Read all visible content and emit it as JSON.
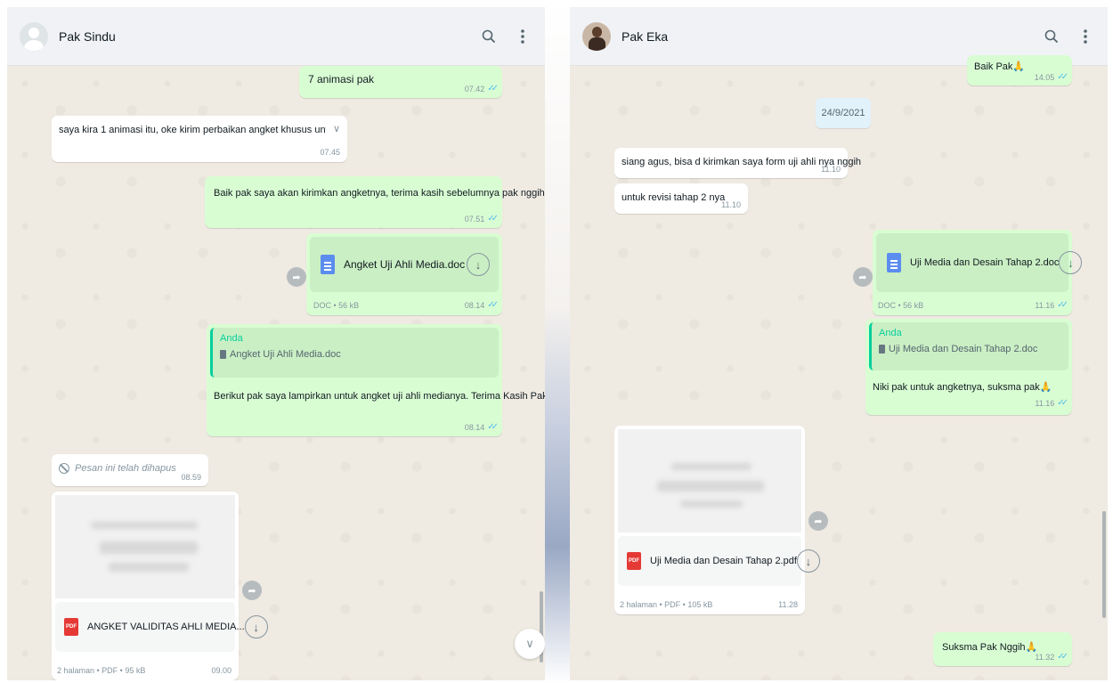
{
  "left_chat": {
    "contact_name": "Pak Sindu",
    "messages": {
      "m1": {
        "text": "7 animasi pak",
        "time": "07.42"
      },
      "m2": {
        "text": "saya kira 1 animasi itu, oke kirim perbaikan angket khusus untuk media saja",
        "time": "07.45"
      },
      "m3": {
        "text": "Baik pak saya akan kirimkan angketnya, terima kasih sebelumnya pak nggih",
        "emoji": "🙏",
        "time": "07.51"
      },
      "m4": {
        "file_name": "Angket Uji Ahli Media.doc",
        "file_info": "DOC • 56 kB",
        "time": "08.14"
      },
      "m5": {
        "reply_author": "Anda",
        "reply_file": "Angket Uji Ahli Media.doc",
        "text": "Berikut pak saya lampirkan untuk angket uji ahli medianya. Terima Kasih Pak",
        "emoji": "🙏",
        "time": "08.14"
      },
      "m6": {
        "text": "Pesan ini telah dihapus",
        "time": "08.59"
      },
      "m7": {
        "file_name": "ANGKET VALIDITAS AHLI MEDIA...",
        "file_info": "2 halaman • PDF • 95 kB",
        "time": "09.00",
        "pdf_label": "PDF"
      }
    }
  },
  "right_chat": {
    "contact_name": "Pak Eka",
    "messages": {
      "m0": {
        "text": "Baik Pak",
        "emoji": "🙏",
        "time": "14.05"
      },
      "date_chip": "24/9/2021",
      "m1": {
        "text": "siang agus, bisa d kirimkan saya form uji ahli nya nggih",
        "time": "11.10"
      },
      "m2": {
        "text": "untuk revisi tahap 2 nya",
        "time": "11.10"
      },
      "m3": {
        "file_name": "Uji Media dan Desain Tahap 2.doc",
        "file_info": "DOC • 56 kB",
        "time": "11.16"
      },
      "m4": {
        "reply_author": "Anda",
        "reply_file": "Uji Media dan Desain Tahap 2.doc",
        "text": "Niki pak untuk angketnya, suksma pak",
        "emoji": "🙏",
        "time": "11.16"
      },
      "m5": {
        "file_name": "Uji Media dan Desain Tahap 2.pdf",
        "file_info": "2 halaman • PDF • 105 kB",
        "time": "11.28",
        "pdf_label": "PDF"
      },
      "m6": {
        "text": "Suksma Pak Nggih",
        "emoji": "🙏",
        "time": "11.32"
      }
    }
  },
  "icons": {
    "search": "search-icon",
    "menu": "menu-dots-icon",
    "download": "download-icon",
    "forward": "forward-icon",
    "scroll_down": "chevron-down-icon",
    "read_ticks": "double-check-icon",
    "deleted": "blocked-icon"
  },
  "colors": {
    "outgoing_bubble": "#d9fdd3",
    "incoming_bubble": "#ffffff",
    "chat_background": "#efeae2",
    "header_background": "#f0f2f5",
    "read_tick": "#53bdeb",
    "reply_accent": "#06cf9c",
    "pdf_red": "#e53935",
    "doc_blue": "#5b8def"
  }
}
